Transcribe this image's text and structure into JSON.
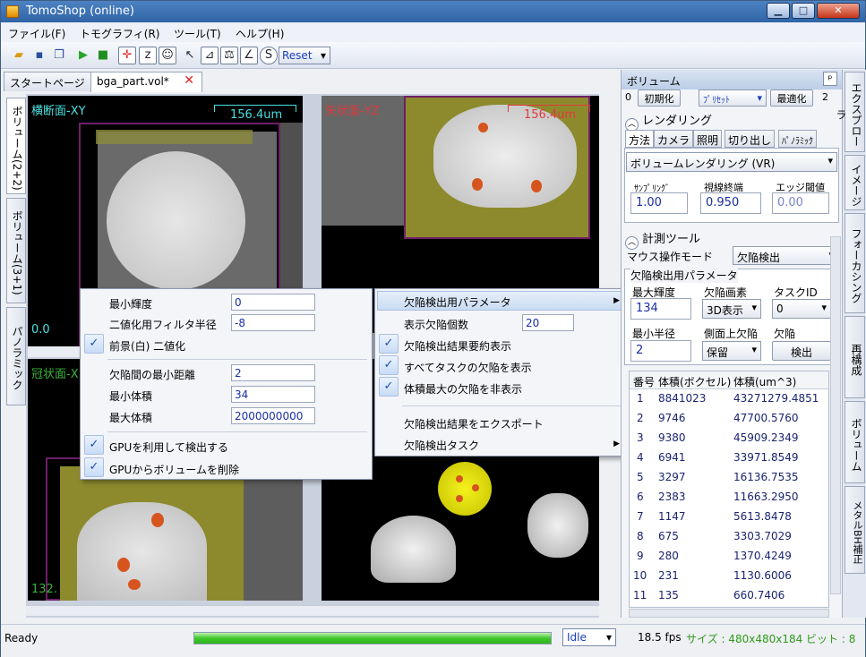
{
  "app": {
    "title": "TomoShop (online)"
  },
  "window_buttons": {
    "minimize": "▁",
    "maximize": "□",
    "close": "✕"
  },
  "menu": [
    "ファイル(F)",
    "トモグラフィ(R)",
    "ツール(T)",
    "ヘルプ(H)"
  ],
  "toolbar": {
    "reset_label": "Reset"
  },
  "tabs": [
    {
      "label": "スタートページ"
    },
    {
      "label": "bga_part.vol*"
    }
  ],
  "left_vtabs": [
    "ボリューム(2+2)",
    "ボリューム(3+1)",
    "パノラミック"
  ],
  "views": {
    "xy_label": "横断面-XY",
    "yz_label": "矢状面-YZ",
    "xz_label": "冠状面-X",
    "scale": "156.4um",
    "xy_value": "0.0",
    "xz_value": "132."
  },
  "context_menu_left": {
    "items": [
      {
        "label": "最小輝度",
        "value": "0"
      },
      {
        "label": "二値化用フィルタ半径",
        "value": "-8"
      },
      {
        "label": "前景(白) 二値化",
        "checked": true
      },
      {
        "label": "欠陥間の最小距離",
        "value": "2"
      },
      {
        "label": "最小体積",
        "value": "34"
      },
      {
        "label": "最大体積",
        "value": "2000000000"
      },
      {
        "label": "GPUを利用して検出する",
        "checked": true
      },
      {
        "label": "GPUからボリュームを削除",
        "checked": true
      }
    ]
  },
  "context_menu_right": {
    "items": [
      {
        "label": "欠陥検出用パラメータ"
      },
      {
        "label": "表示欠陥個数",
        "value": "20"
      },
      {
        "label": "欠陥検出結果要約表示",
        "checked": true
      },
      {
        "label": "すべてタスクの欠陥を表示",
        "checked": true
      },
      {
        "label": "体積最大の欠陥を非表示",
        "checked": true
      },
      {
        "label": "欠陥検出結果をエクスポート"
      },
      {
        "label": "欠陥検出タスク"
      }
    ]
  },
  "right_panel": {
    "title": "ボリューム",
    "pin_icon": "ᵖ",
    "top_left": "0",
    "top_right": "2",
    "init_button": "初期化",
    "preset": "ﾌﾟﾘｾｯﾄ",
    "optimize_button": "最適化",
    "rendering_title": "レンダリング",
    "render_tabs": [
      "方法",
      "カメラ",
      "照明",
      "切り出し",
      "ﾊﾟﾉﾗﾐｯｸ"
    ],
    "render_method": "ボリュームレンダリング (VR)",
    "sampling_label": "ｻﾝﾌﾟﾘﾝｸﾞ",
    "sampling_value": "1.00",
    "ray_end_label": "視線終端",
    "ray_end_value": "0.950",
    "edge_label": "エッジ閾値",
    "edge_value": "0.00",
    "measure_title": "計測ツール",
    "mouse_mode_label": "マウス操作モード",
    "mouse_mode_value": "欠陥検出",
    "params_title": "欠陥検出用パラメータ",
    "max_lum_label": "最大輝度",
    "max_lum_value": "134",
    "defect_px_label": "欠陥画素",
    "defect_px_value": "3D表示",
    "task_label": "タスクID",
    "task_value": "0",
    "min_radius_label": "最小半径",
    "min_radius_value": "2",
    "side_label": "側面上欠陥",
    "side_value": "保留",
    "defect_label": "欠陥",
    "detect_button": "検出",
    "table_headers": [
      "番号",
      "体積(ボクセル)",
      "体積(um^3)"
    ],
    "rows": [
      [
        "1",
        "8841023",
        "43271279.4851"
      ],
      [
        "2",
        "9746",
        "47700.5760"
      ],
      [
        "3",
        "9380",
        "45909.2349"
      ],
      [
        "4",
        "6941",
        "33971.8549"
      ],
      [
        "5",
        "3297",
        "16136.7535"
      ],
      [
        "6",
        "2383",
        "11663.2950"
      ],
      [
        "7",
        "1147",
        "5613.8478"
      ],
      [
        "8",
        "675",
        "3303.7029"
      ],
      [
        "9",
        "280",
        "1370.4249"
      ],
      [
        "10",
        "231",
        "1130.6006"
      ],
      [
        "11",
        "135",
        "660.7406"
      ]
    ]
  },
  "right_strip": [
    "エクスプローラ",
    "イメージ",
    "フォーカシング",
    "再構成",
    "ボリューム",
    "メタルBH補正"
  ],
  "status": {
    "ready": "Ready",
    "progress": 1.0,
    "mode": "Idle",
    "fps": "18.5 fps",
    "size": "サイズ : 480x480x184  ビット : 8"
  }
}
